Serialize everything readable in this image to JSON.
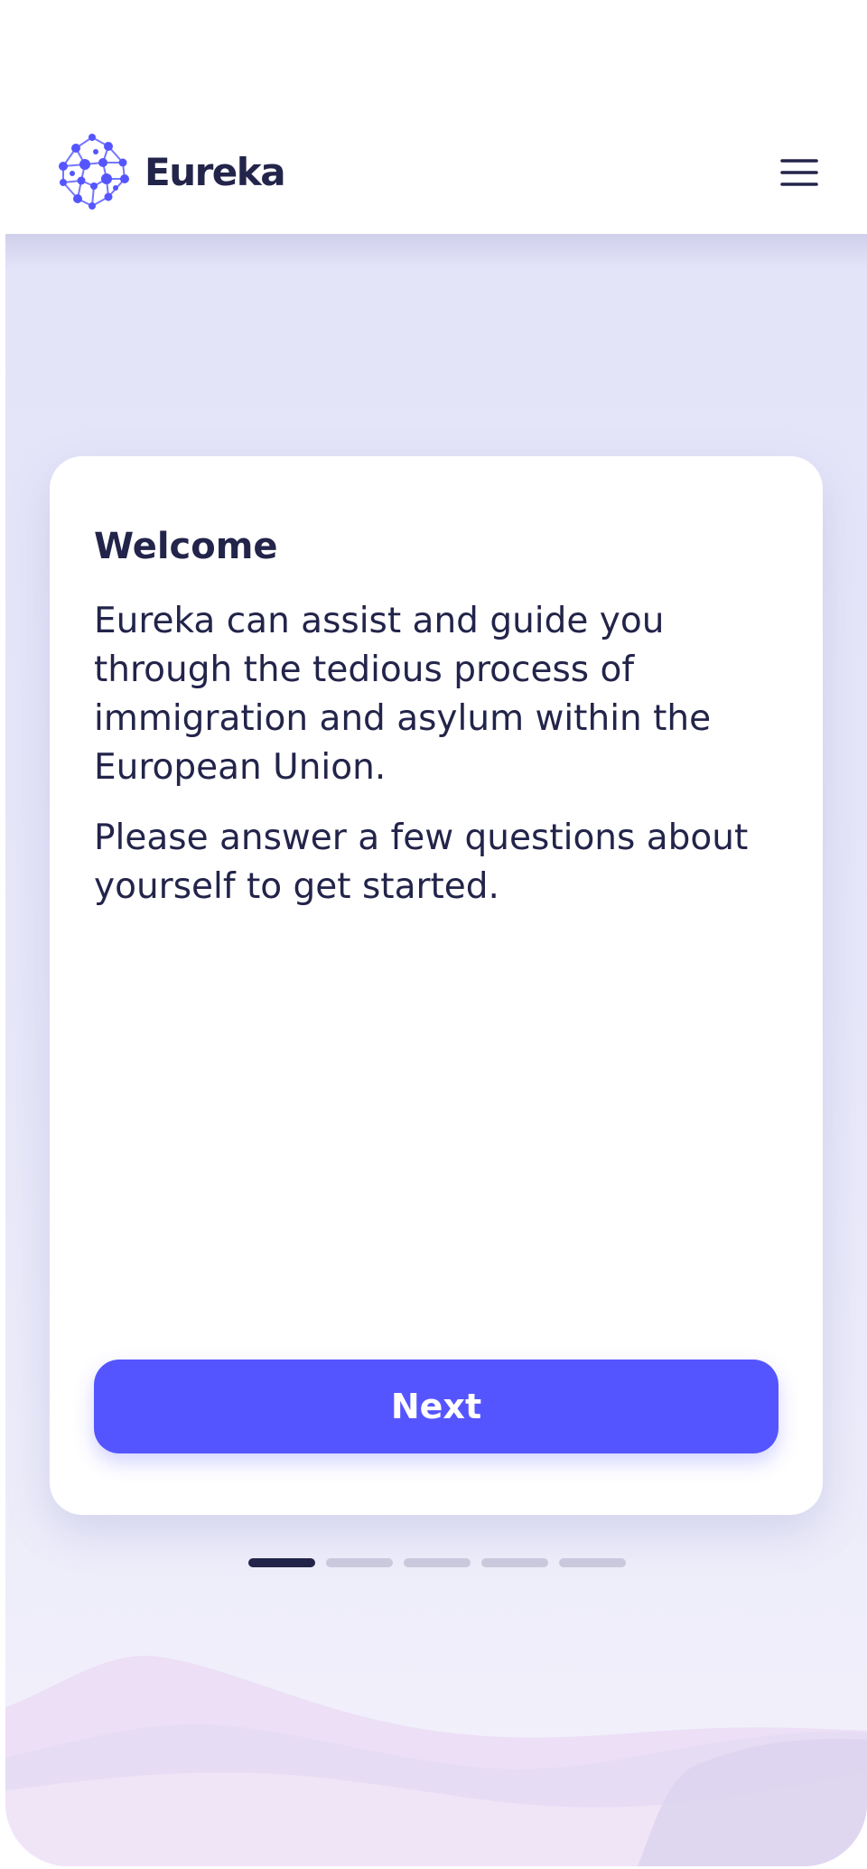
{
  "header": {
    "logo_text": "Eureka",
    "logo_icon": "network-globe-icon",
    "menu_icon": "hamburger-menu-icon"
  },
  "card": {
    "title": "Welcome",
    "paragraphs": [
      "Eureka can assist and guide you through the tedious process of immigration and asylum within the European Union.",
      "Please answer a few questions about yourself to get started."
    ],
    "next_label": "Next"
  },
  "progress": {
    "total_steps": 5,
    "current_step": 1
  },
  "colors": {
    "accent": "#5555ff",
    "text": "#23244a",
    "background": "#e4e4f9",
    "step_inactive": "#c9c8dc"
  }
}
